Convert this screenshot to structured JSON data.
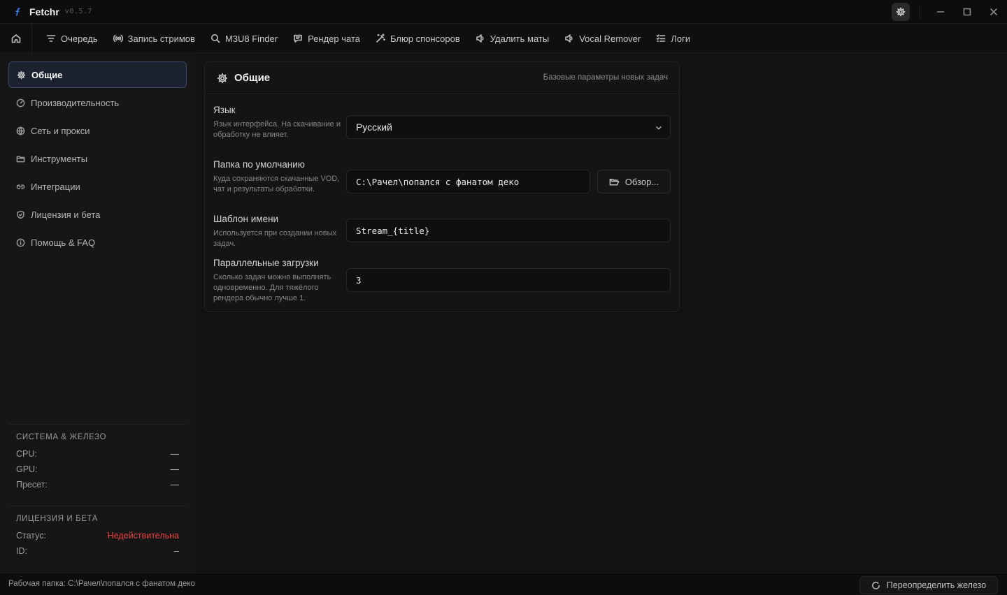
{
  "app": {
    "name": "Fetchr",
    "version": "v0.5.7"
  },
  "nav": {
    "items": [
      {
        "label": "Очередь",
        "icon": "filter-icon"
      },
      {
        "label": "Запись стримов",
        "icon": "broadcast-icon"
      },
      {
        "label": "M3U8 Finder",
        "icon": "search-icon"
      },
      {
        "label": "Рендер чата",
        "icon": "chat-icon"
      },
      {
        "label": "Блюр спонсоров",
        "icon": "magic-wand-icon"
      },
      {
        "label": "Удалить маты",
        "icon": "speaker-icon"
      },
      {
        "label": "Vocal Remover",
        "icon": "speaker-icon"
      },
      {
        "label": "Логи",
        "icon": "list-icon"
      }
    ]
  },
  "sidebar": {
    "items": [
      {
        "label": "Общие",
        "icon": "gear-icon",
        "active": true
      },
      {
        "label": "Производительность",
        "icon": "gauge-icon"
      },
      {
        "label": "Сеть и прокси",
        "icon": "globe-icon"
      },
      {
        "label": "Инструменты",
        "icon": "folder-icon"
      },
      {
        "label": "Интеграции",
        "icon": "link-icon"
      },
      {
        "label": "Лицензия и бета",
        "icon": "shield-icon"
      },
      {
        "label": "Помощь & FAQ",
        "icon": "info-icon"
      }
    ],
    "system": {
      "title": "Система & железо",
      "cpu_label": "CPU:",
      "cpu_value": "—",
      "gpu_label": "GPU:",
      "gpu_value": "—",
      "preset_label": "Пресет:",
      "preset_value": "—"
    },
    "license": {
      "title": "Лицензия и бета",
      "status_label": "Статус:",
      "status_value": "Недействительна",
      "id_label": "ID:",
      "id_value": "–"
    }
  },
  "card": {
    "title": "Общие",
    "subtitle": "Базовые параметры новых задач",
    "language": {
      "label": "Язык",
      "desc": "Язык интерфейса. На скачивание и обработку не влияет.",
      "value": "Русский"
    },
    "folder": {
      "label": "Папка по умолчанию",
      "desc": "Куда сохраняются скачанные VOD, чат и результаты обработки.",
      "value": "C:\\Рачел\\попался с фанатом деко",
      "browse": "Обзор..."
    },
    "template": {
      "label": "Шаблон имени",
      "desc": "Используется при создании новых задач.",
      "value": "Stream_{title}"
    },
    "parallel": {
      "label": "Параллельные загрузки",
      "desc": "Сколько задач можно выполнять одновременно. Для тяжёлого рендера обычно лучше 1.",
      "value": "3"
    }
  },
  "status": {
    "text": "Рабочая папка: C:\\Рачел\\попался с фанатом деко",
    "override": "Переопределить железо"
  },
  "colors": {
    "accent": "#3a4a66",
    "danger": "#ef4444",
    "logo": "#3b82f6"
  }
}
